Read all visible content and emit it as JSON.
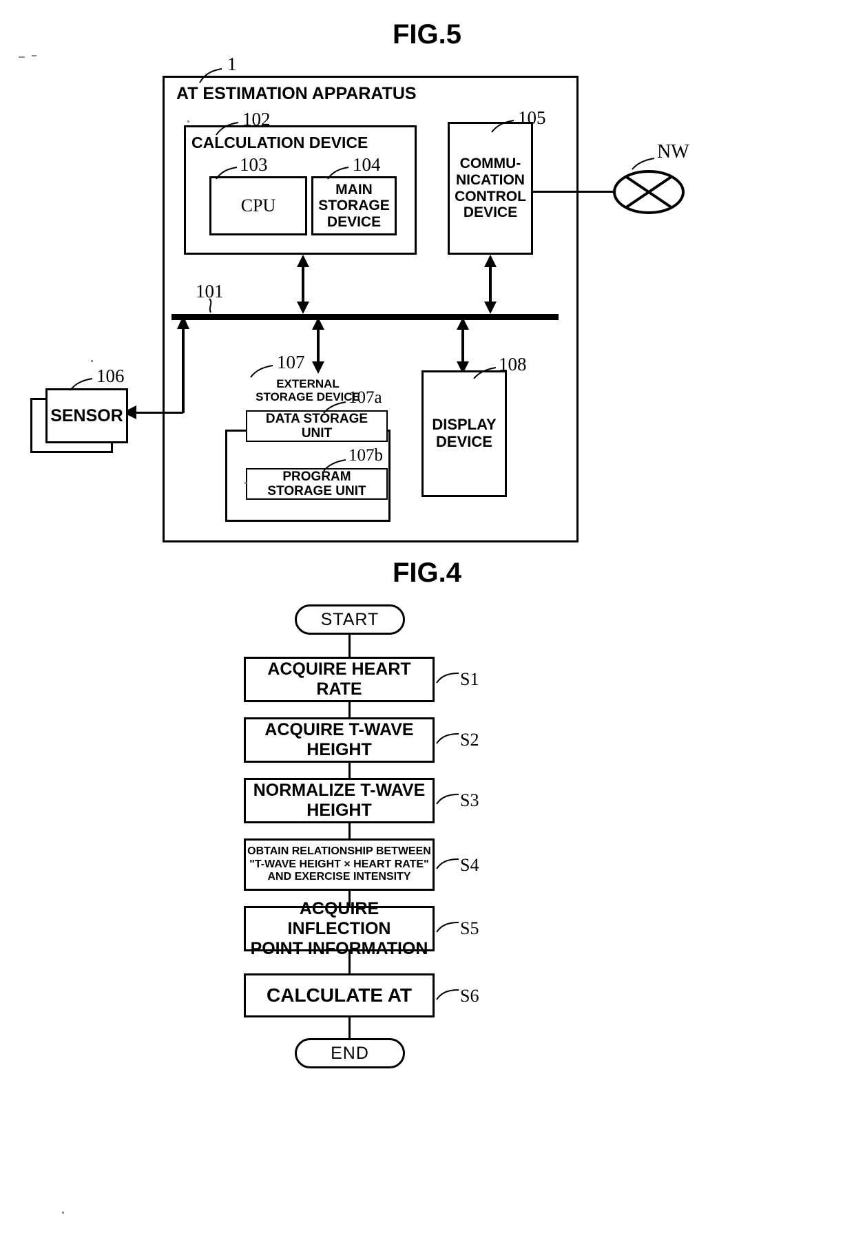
{
  "figures": [
    {
      "id": "fig5",
      "title": "FIG.5",
      "apparatus": {
        "ref": "1",
        "label": "AT ESTIMATION APPARATUS"
      },
      "blocks": {
        "calculation_device": {
          "ref": "102",
          "label": "CALCULATION DEVICE"
        },
        "cpu": {
          "ref": "103",
          "label": "CPU"
        },
        "main_storage_device": {
          "ref": "104",
          "label": "MAIN\nSTORAGE\nDEVICE"
        },
        "communication_control_device": {
          "ref": "105",
          "label": "COMMU-\nNICATION\nCONTROL\nDEVICE"
        },
        "bus": {
          "ref": "101"
        },
        "sensor": {
          "ref": "106",
          "label": "SENSOR"
        },
        "external_storage_device": {
          "ref": "107",
          "label": "EXTERNAL\nSTORAGE DEVICE"
        },
        "data_storage_unit": {
          "ref": "107a",
          "label": "DATA STORAGE\nUNIT"
        },
        "program_storage_unit": {
          "ref": "107b",
          "label": "PROGRAM\nSTORAGE UNIT"
        },
        "display_device": {
          "ref": "108",
          "label": "DISPLAY\nDEVICE"
        },
        "network": {
          "ref": "NW",
          "label": "NW"
        }
      }
    },
    {
      "id": "fig4",
      "title": "FIG.4",
      "flow": {
        "start": "START",
        "end": "END",
        "steps": [
          {
            "ref": "S1",
            "label": "ACQUIRE HEART\nRATE"
          },
          {
            "ref": "S2",
            "label": "ACQUIRE T-WAVE\nHEIGHT"
          },
          {
            "ref": "S3",
            "label": "NORMALIZE T-WAVE\nHEIGHT"
          },
          {
            "ref": "S4",
            "label": "OBTAIN RELATIONSHIP BETWEEN\n\"T-WAVE HEIGHT × HEART RATE\"\nAND EXERCISE INTENSITY"
          },
          {
            "ref": "S5",
            "label": "ACQUIRE INFLECTION\nPOINT INFORMATION"
          },
          {
            "ref": "S6",
            "label": "CALCULATE AT"
          }
        ]
      }
    }
  ]
}
